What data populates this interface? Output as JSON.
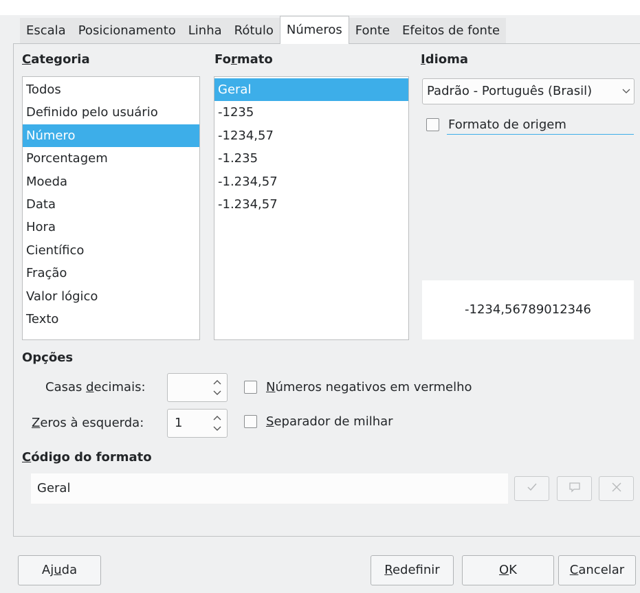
{
  "tabs": [
    "Escala",
    "Posicionamento",
    "Linha",
    "Rótulo",
    "Números",
    "Fonte",
    "Efeitos de fonte"
  ],
  "active_tab": "Números",
  "category": {
    "label": "Categoria",
    "items": [
      "Todos",
      "Definido pelo usuário",
      "Número",
      "Porcentagem",
      "Moeda",
      "Data",
      "Hora",
      "Científico",
      "Fração",
      "Valor lógico",
      "Texto"
    ],
    "selected": "Número"
  },
  "format": {
    "label": "Formato",
    "items": [
      "Geral",
      "-1235",
      "-1234,57",
      "-1.235",
      "-1.234,57",
      "-1.234,57"
    ],
    "selected": "Geral"
  },
  "language": {
    "label": "Idioma",
    "value": "Padrão - Português (Brasil)",
    "source_format_label": "Formato de origem",
    "source_format_checked": false
  },
  "preview": {
    "value": "-1234,56789012346"
  },
  "options": {
    "label": "Opções",
    "decimal_places_label": "Casas decimais:",
    "decimal_places_value": "",
    "leading_zeros_label": "Zeros à esquerda:",
    "leading_zeros_value": "1",
    "negative_red_label": "Números negativos em vermelho",
    "negative_red_checked": false,
    "thousands_sep_label": "Separador de milhar",
    "thousands_sep_checked": false
  },
  "format_code": {
    "label": "Código do formato",
    "value": "Geral",
    "accept_icon": "check-icon",
    "comment_icon": "comment-icon",
    "delete_icon": "close-icon"
  },
  "buttons": {
    "help": "Ajuda",
    "reset": "Redefinir",
    "ok": "OK",
    "cancel": "Cancelar"
  },
  "colors": {
    "accent": "#3daee9",
    "dialog_bg": "#eff0f1"
  }
}
